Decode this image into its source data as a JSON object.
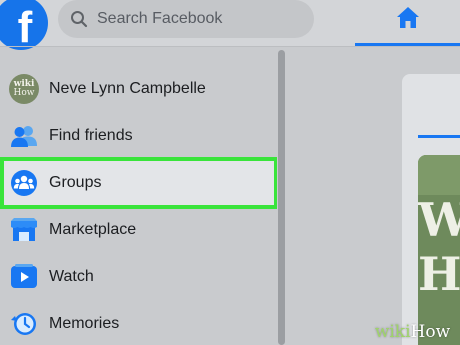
{
  "topbar": {
    "logo": {
      "letter": "f",
      "icon": "facebook-logo-icon",
      "color": "#1674ea"
    },
    "search": {
      "placeholder": "Search Facebook",
      "icon": "search-icon"
    },
    "home_tab": {
      "icon": "home-icon",
      "active": true,
      "accent": "#1877f2"
    }
  },
  "sidebar": {
    "items": [
      {
        "label": "Neve Lynn Campbelle",
        "icon": "avatar"
      },
      {
        "label": "Find friends",
        "icon": "friends-icon"
      },
      {
        "label": "Groups",
        "icon": "groups-icon",
        "highlighted": true
      },
      {
        "label": "Marketplace",
        "icon": "marketplace-icon"
      },
      {
        "label": "Watch",
        "icon": "watch-icon"
      },
      {
        "label": "Memories",
        "icon": "memories-icon"
      }
    ],
    "avatar_text": "wiki How",
    "highlight_color": "#39e43b"
  },
  "main": {
    "story_image_letters": [
      "W",
      "H"
    ]
  },
  "watermark": {
    "wiki": "wiki",
    "how": "How"
  }
}
